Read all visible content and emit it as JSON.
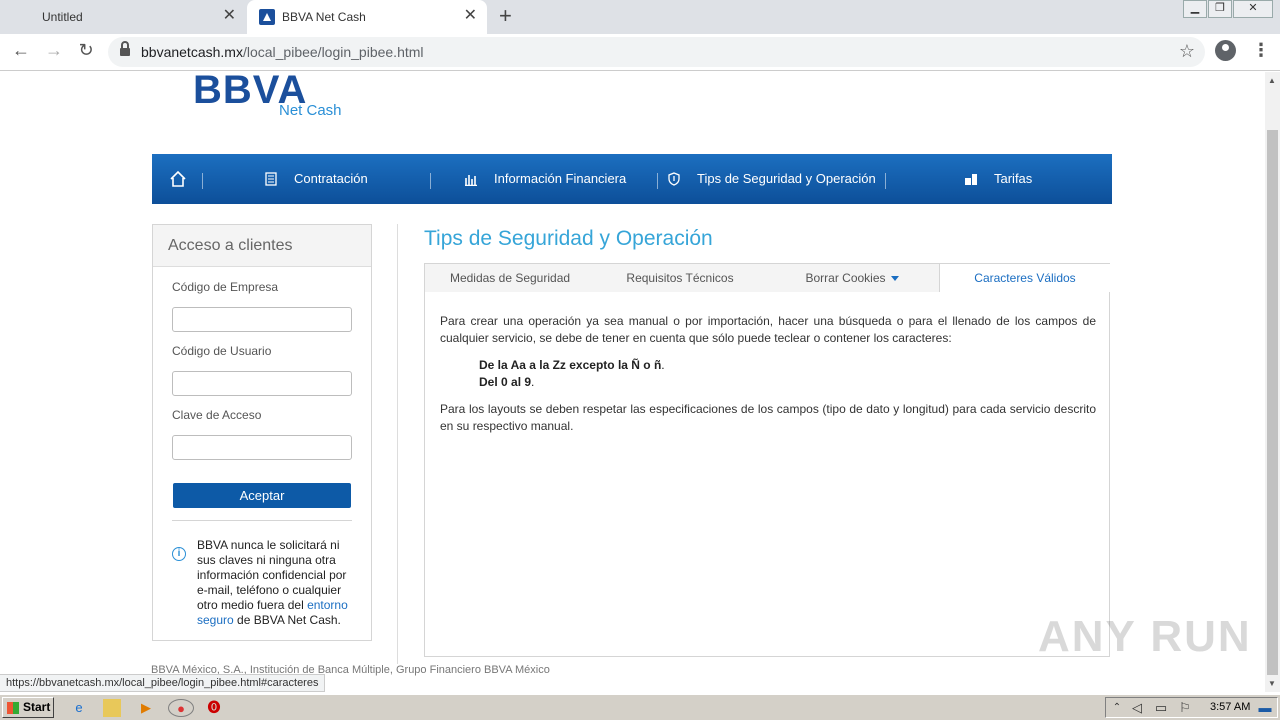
{
  "browser": {
    "tabs": [
      {
        "title": "Untitled",
        "active": false
      },
      {
        "title": "BBVA Net Cash",
        "active": true
      }
    ],
    "url_host": "bbvanetcash.mx",
    "url_path": "/local_pibee/login_pibee.html",
    "status_url": "https://bbvanetcash.mx/local_pibee/login_pibee.html#caracteres"
  },
  "logo": {
    "main": "BBVA",
    "sub": "Net Cash"
  },
  "nav": {
    "items": [
      "Contratación",
      "Información Financiera",
      "Tips de Seguridad y Operación",
      "Tarifas"
    ]
  },
  "login": {
    "title": "Acceso a clientes",
    "company_label": "Código de Empresa",
    "user_label": "Código de Usuario",
    "password_label": "Clave de Acceso",
    "accept_label": "Aceptar",
    "notice_before": "BBVA nunca le solicitará ni sus claves ni ninguna otra información confidencial por e-mail, teléfono o cualquier otro medio fuera del ",
    "notice_link": "entorno seguro",
    "notice_after": " de BBVA Net Cash."
  },
  "tips": {
    "title": "Tips de Seguridad y Operación",
    "tabs": [
      "Medidas de Seguridad",
      "Requisitos Técnicos",
      "Borrar Cookies",
      "Caracteres Válidos"
    ],
    "para1": "Para crear una operación ya sea manual o por importación, hacer una búsqueda o para el llenado de los campos de cualquier servicio, se debe de tener en cuenta que sólo puede teclear o contener los caracteres:",
    "rule1_bold": "De la Aa a la Zz excepto la Ñ o ñ",
    "rule2_bold": "Del 0 al 9",
    "para2": "Para los layouts se deben respetar las especificaciones de los campos (tipo de dato y longitud) para cada servicio descrito en su respectivo manual."
  },
  "footer": "BBVA México, S.A., Institución de Banca Múltiple, Grupo Financiero BBVA México",
  "watermark": "ANY RUN",
  "taskbar": {
    "start": "Start",
    "clock": "3:57 AM"
  },
  "colors": {
    "brand": "#1b4f9c",
    "accent": "#36a5d8",
    "nav_bg": "#0d5aa7"
  }
}
